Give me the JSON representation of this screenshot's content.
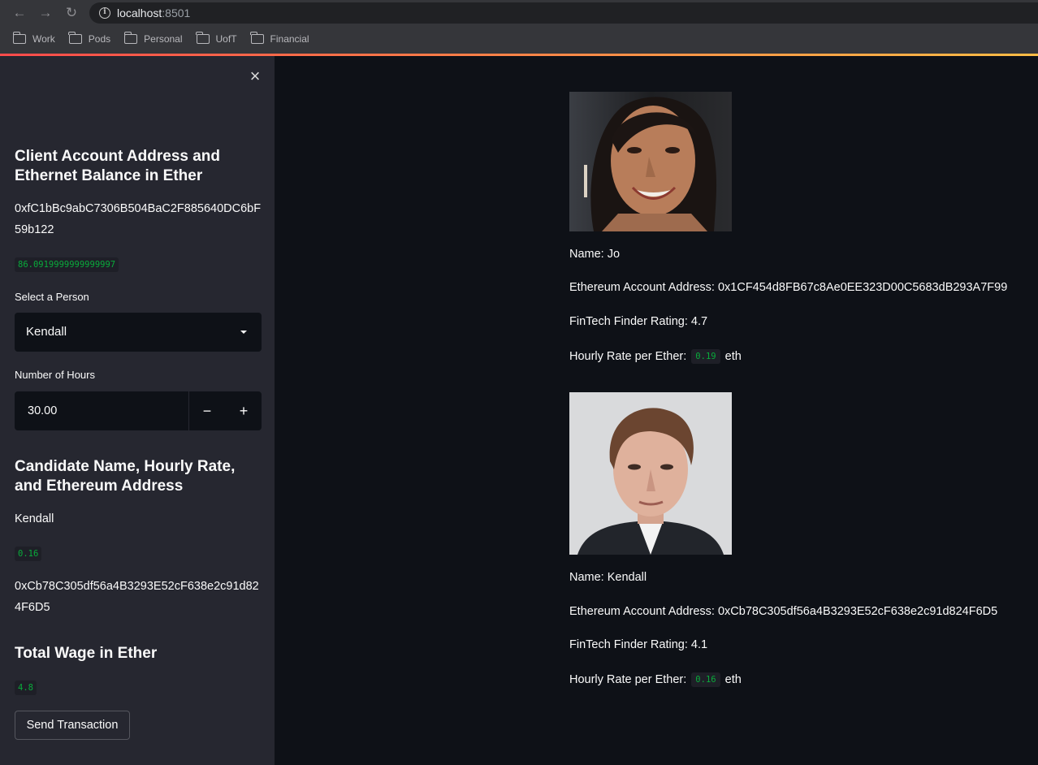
{
  "browser": {
    "url_host": "localhost",
    "url_port": ":8501",
    "bookmarks": [
      "Work",
      "Pods",
      "Personal",
      "UofT",
      "Financial"
    ]
  },
  "sidebar": {
    "client_heading": "Client Account Address and Ethernet Balance in Ether",
    "client_address": "0xfC1bBc9abC7306B504BaC2F885640DC6bF59b122",
    "client_balance": "86.0919999999999997",
    "select_label": "Select a Person",
    "selected_person": "Kendall",
    "hours_label": "Number of Hours",
    "hours_value": "30.00",
    "minus": "−",
    "plus": "+",
    "candidate_heading": "Candidate Name, Hourly Rate, and Ethereum Address",
    "candidate_name": "Kendall",
    "candidate_rate": "0.16",
    "candidate_address": "0xCb78C305df56a4B3293E52cF638e2c91d824F6D5",
    "wage_heading": "Total Wage in Ether",
    "wage_value": "4.8",
    "send_label": "Send Transaction"
  },
  "candidates": [
    {
      "name_line": "Name: Jo",
      "address_line": "Ethereum Account Address: 0x1CF454d8FB67c8Ae0EE323D00C5683dB293A7F99",
      "rating_line": "FinTech Finder Rating: 4.7",
      "rate_prefix": "Hourly Rate per Ether:",
      "rate_value": "0.19",
      "rate_suffix": "eth"
    },
    {
      "name_line": "Name: Kendall",
      "address_line": "Ethereum Account Address: 0xCb78C305df56a4B3293E52cF638e2c91d824F6D5",
      "rating_line": "FinTech Finder Rating: 4.1",
      "rate_prefix": "Hourly Rate per Ether:",
      "rate_value": "0.16",
      "rate_suffix": "eth"
    }
  ],
  "colors": {
    "app_bg": "#0e1117",
    "sidebar_bg": "#262730",
    "code_green": "#09ab3b",
    "accent_red": "#ff4b4b",
    "accent_yellow": "#ffbd45"
  },
  "icons": [
    "back-arrow-icon",
    "forward-arrow-icon",
    "reload-icon",
    "info-icon",
    "folder-icon",
    "close-icon",
    "dropdown-caret-icon"
  ]
}
